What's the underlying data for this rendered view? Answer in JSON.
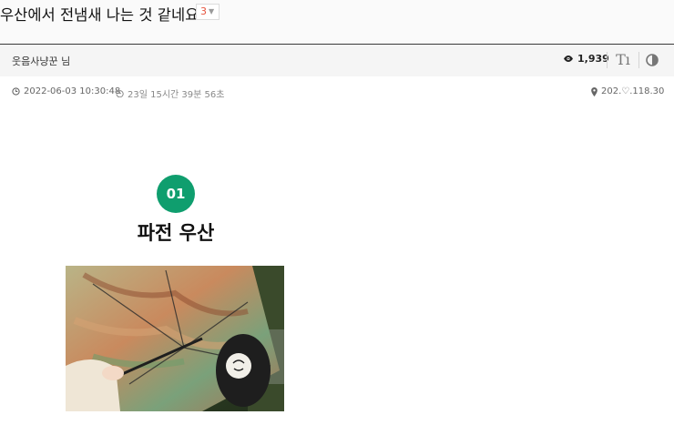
{
  "post": {
    "title": "우산에서 전냄새 나는 것 같네요",
    "comment_count": "3"
  },
  "author": {
    "name": "웃음사냥꾼 님",
    "views": "1,939"
  },
  "meta": {
    "datetime": "2022-06-03 10:30:48",
    "elapsed": "23일 15시간 39분 56초",
    "ip": "202.♡.118.30"
  },
  "content": {
    "badge": "01",
    "heading": "파전 우산"
  },
  "icons": {
    "views": "eye-icon",
    "font": "font-size-icon",
    "theme": "contrast-icon",
    "clock": "clock-icon",
    "history": "history-icon",
    "location": "map-pin-icon"
  },
  "colors": {
    "badge_bg": "#0f9e6e",
    "comment_count": "#e5533d"
  }
}
